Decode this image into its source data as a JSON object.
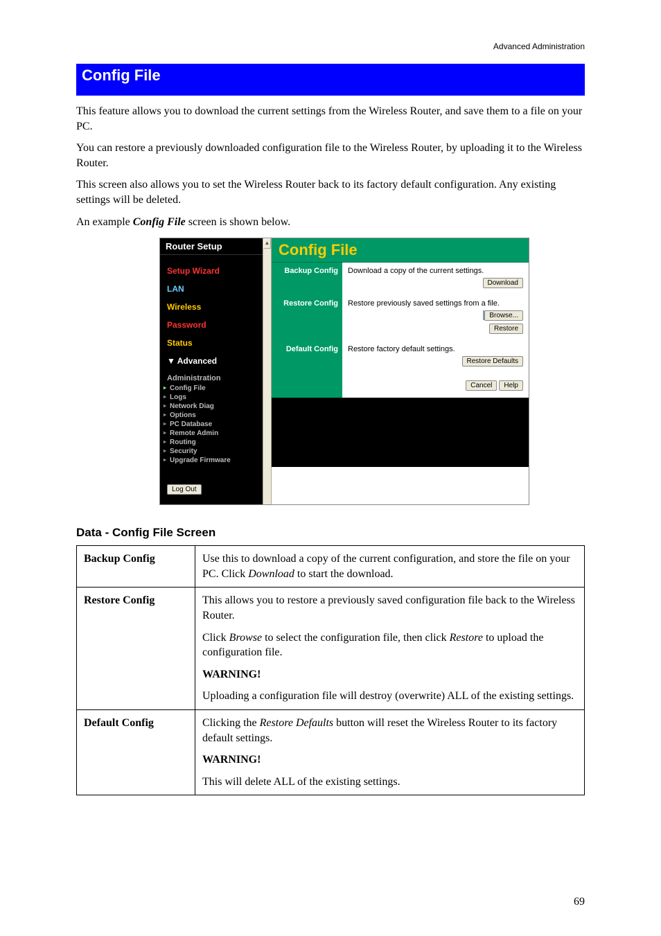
{
  "header": {
    "right": "Advanced Administration"
  },
  "section_title": "Config File",
  "paragraphs": {
    "p1": "This feature allows you to download the current settings from the Wireless Router, and save them to a file on your PC.",
    "p2": "You can restore a previously downloaded configuration file to the Wireless Router, by uploading it to the Wireless Router.",
    "p3": "This screen also allows you to set the Wireless Router back to its factory default configuration. Any existing settings will be deleted.",
    "p4_pre": "An example ",
    "p4_em": "Config File",
    "p4_post": " screen is shown below."
  },
  "screenshot": {
    "sidebar_title": "Router Setup",
    "nav": {
      "setup_wizard": "Setup Wizard",
      "lan": "LAN",
      "wireless": "Wireless",
      "password": "Password",
      "status": "Status",
      "advanced": "▼ Advanced"
    },
    "subhead": "Administration",
    "subnav": {
      "config_file": "Config File",
      "logs": "Logs",
      "network_diag": "Network Diag",
      "options": "Options",
      "pc_database": "PC Database",
      "remote_admin": "Remote Admin",
      "routing": "Routing",
      "security": "Security",
      "upgrade_firmware": "Upgrade Firmware"
    },
    "logout": "Log Out",
    "panel": {
      "title": "Config File",
      "backup_label": "Backup Config",
      "backup_text": "Download a copy of the current settings.",
      "download_btn": "Download",
      "restore_label": "Restore Config",
      "restore_text": "Restore previously saved settings from a file.",
      "browse_btn": "Browse...",
      "restore_btn": "Restore",
      "default_label": "Default Config",
      "default_text": "Restore factory default settings.",
      "restore_defaults_btn": "Restore Defaults",
      "cancel_btn": "Cancel",
      "help_btn": "Help"
    }
  },
  "data_head": "Data - Config File Screen",
  "table": {
    "r1_k": "Backup Config",
    "r1_v_pre": "Use this to download a copy of the current configuration, and store the file on your PC. Click ",
    "r1_v_em": "Download",
    "r1_v_post": " to start the download.",
    "r2_k": "Restore Config",
    "r2_p1": "This allows you to restore a previously saved configuration file back to the Wireless Router.",
    "r2_p2_pre": "Click ",
    "r2_p2_em1": "Browse",
    "r2_p2_mid": " to select the configuration file, then click ",
    "r2_p2_em2": "Restore",
    "r2_p2_post": " to upload the configuration file.",
    "r2_warn": "WARNING!",
    "r2_p3": "Uploading a configuration file will destroy (overwrite) ALL of the existing settings.",
    "r3_k": "Default Config",
    "r3_p1_pre": "Clicking the ",
    "r3_p1_em": "Restore Defaults",
    "r3_p1_post": " button will reset the Wireless Router to its factory default settings.",
    "r3_warn": "WARNING!",
    "r3_p2": "This will delete ALL of the existing settings."
  },
  "page_num": "69"
}
